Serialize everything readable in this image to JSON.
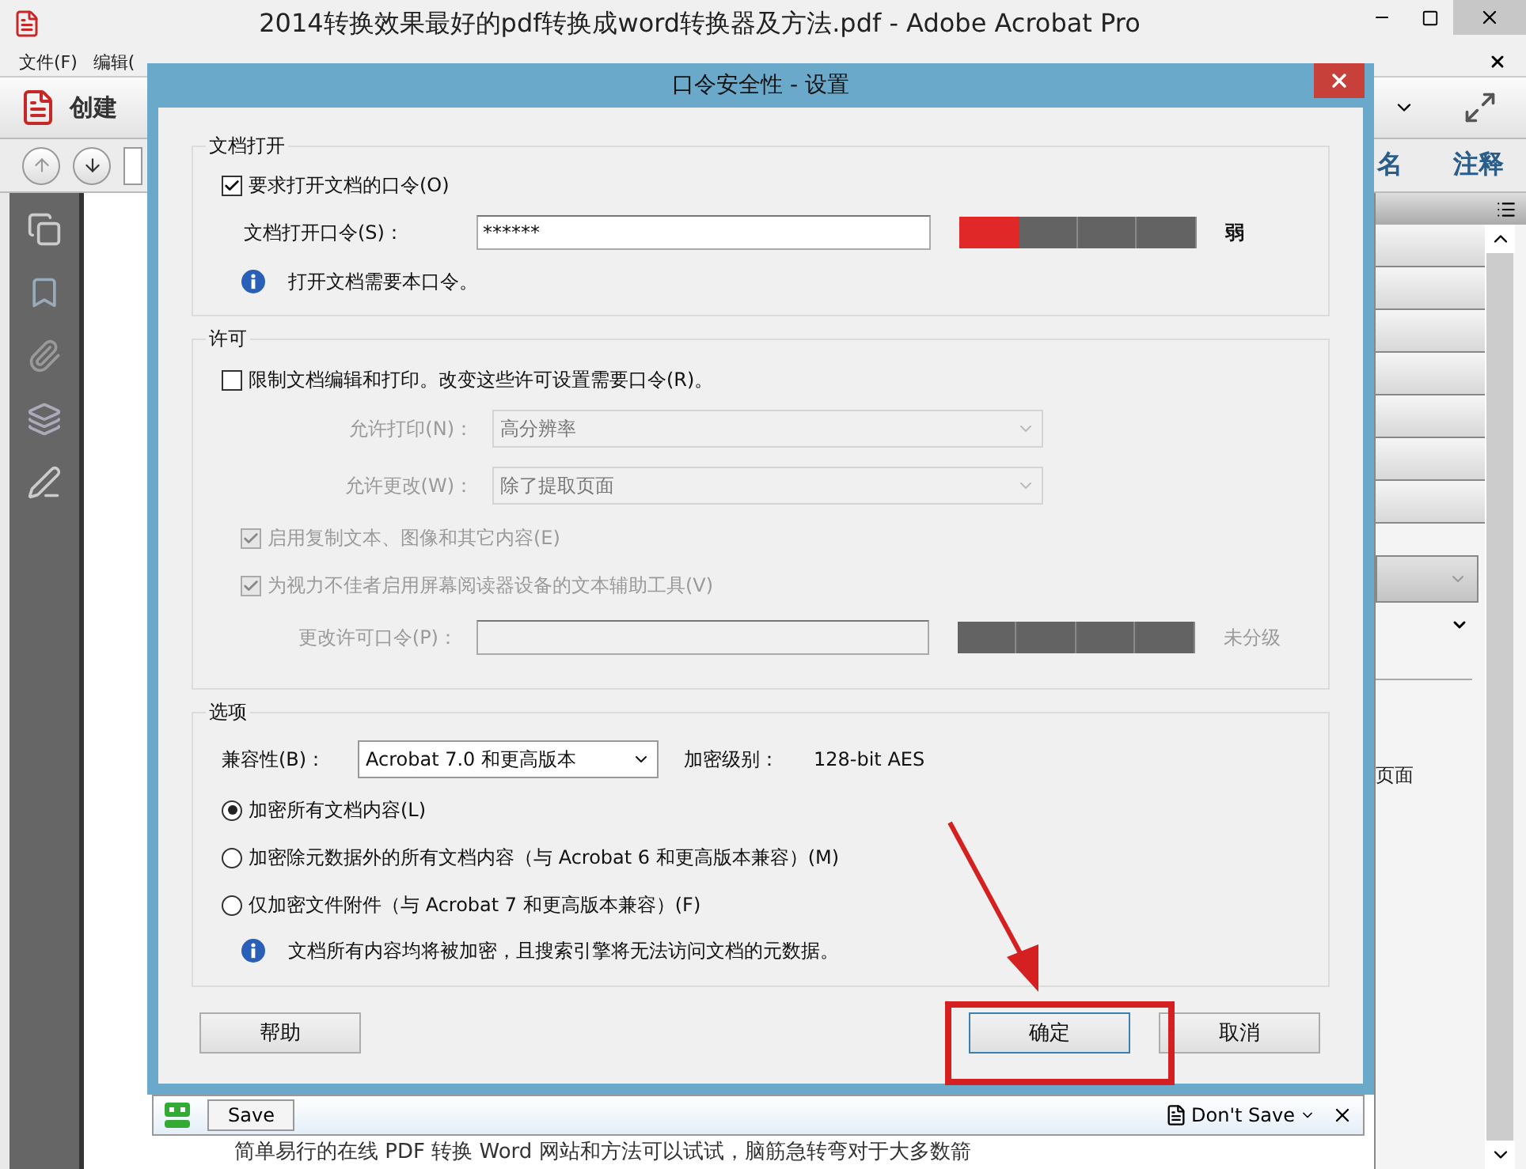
{
  "app": {
    "title": "2014转换效果最好的pdf转换成word转换器及方法.pdf - Adobe Acrobat Pro",
    "menu": [
      "文件(F)",
      "编辑("
    ],
    "create": "创建",
    "panel_tabs": [
      "名",
      "注释"
    ],
    "panel_text": "页面",
    "doc_text": "简单易行的在线 PDF 转换 Word 网站和方法可以试试，脑筋急转弯对于大多数箭"
  },
  "dialog": {
    "title": "口令安全性 - 设置",
    "open": {
      "legend": "文档打开",
      "require": {
        "label": "要求打开文档的口令(O)",
        "checked": true
      },
      "password": {
        "label": "文档打开口令(S)：",
        "value": "******",
        "level": 0.25,
        "reading": "弱",
        "disabled": false
      },
      "info": "打开文档需要本口令。"
    },
    "permissions": {
      "legend": "许可",
      "restrict": {
        "label": "限制文档编辑和打印。改变这些许可设置需要口令(R)。",
        "checked": false
      },
      "selects": [
        {
          "label": "允许打印(N)：",
          "value": "高分辨率",
          "disabled": true
        },
        {
          "label": "允许更改(W)：",
          "value": "除了提取页面",
          "disabled": true
        }
      ],
      "checks": [
        {
          "label": "启用复制文本、图像和其它内容(E)",
          "checked": true,
          "disabled": true
        },
        {
          "label": "为视力不佳者启用屏幕阅读器设备的文本辅助工具(V)",
          "checked": true,
          "disabled": true
        }
      ],
      "password": {
        "label": "更改许可口令(P)：",
        "reading": "未分级",
        "disabled": true
      }
    },
    "options": {
      "legend": "选项",
      "compat": {
        "label": "兼容性(B)：",
        "value": "Acrobat 7.0 和更高版本"
      },
      "encryption": {
        "label": "加密级别：",
        "value": "128-bit AES"
      },
      "radios": [
        {
          "label": "加密所有文档内容(L)",
          "selected": true
        },
        {
          "label": "加密除元数据外的所有文档内容（与 Acrobat 6 和更高版本兼容）(M)",
          "selected": false
        },
        {
          "label": "仅加密文件附件（与 Acrobat 7 和更高版本兼容）(F)",
          "selected": false
        }
      ],
      "info": "文档所有内容均将被加密，且搜索引擎将无法访问文档的元数据。"
    },
    "buttons": {
      "help": "帮助",
      "ok": "确定",
      "cancel": "取消"
    }
  },
  "save_bar": {
    "save": "Save",
    "dont_save": "Don't Save"
  }
}
